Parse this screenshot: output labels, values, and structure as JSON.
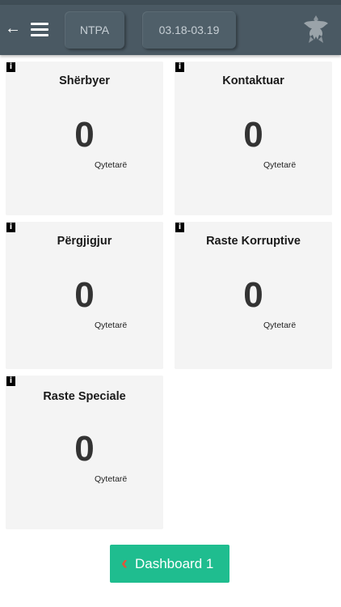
{
  "appbar": {
    "back_icon": "arrow-left-icon",
    "menu_icon": "hamburger-menu-icon",
    "tabs": [
      {
        "label": "NTPA"
      },
      {
        "label": "03.18-03.19"
      }
    ],
    "logo": "albanian-eagle-emblem"
  },
  "cards": [
    {
      "info_label": "i",
      "title": "Shërbyer",
      "value": "0",
      "unit": "Qytetarë"
    },
    {
      "info_label": "i",
      "title": "Kontaktuar",
      "value": "0",
      "unit": "Qytetarë"
    },
    {
      "info_label": "i",
      "title": "Përgjigjur",
      "value": "0",
      "unit": "Qytetarë"
    },
    {
      "info_label": "i",
      "title": "Raste Korruptive",
      "value": "0",
      "unit": "Qytetarë"
    },
    {
      "info_label": "i",
      "title": "Raste Speciale",
      "value": "0",
      "unit": "Qytetarë"
    }
  ],
  "footer": {
    "chevron_icon": "chevron-left-icon",
    "button_label": "Dashboard 1"
  },
  "colors": {
    "appbar": "#4a5963",
    "card_bg": "#f4f4f4",
    "button_bg": "#1fbd8f",
    "chevron": "#e0553a"
  }
}
